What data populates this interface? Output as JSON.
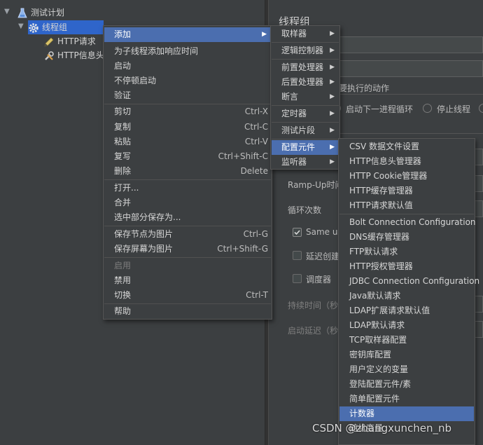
{
  "tree": {
    "items": [
      {
        "label": "测试计划",
        "icon": "flask-icon"
      },
      {
        "label": "线程组",
        "icon": "gear-icon"
      },
      {
        "label": "HTTP请求",
        "icon": "pencil-icon"
      },
      {
        "label": "HTTP信息头",
        "icon": "wrench-icon"
      }
    ]
  },
  "right": {
    "title": "线程组",
    "action_label": "要执行的动作",
    "opt_next_loop": "启动下一进程循环",
    "opt_stop_thread": "停止线程",
    "rampup_label": "Ramp-Up时间",
    "loop_label": "循环次数",
    "same_user_label": "Same us",
    "delay_label": "延迟创建",
    "scheduler_label": "调度器",
    "duration_label": "持续时间（秒",
    "startup_delay_label": "启动延迟（秒"
  },
  "context_menu": {
    "items": [
      {
        "label": "添加",
        "submenu": true
      },
      {
        "label": "为子线程添加响应时间"
      },
      {
        "label": "启动"
      },
      {
        "label": "不停顿启动"
      },
      {
        "label": "验证"
      },
      {
        "label": "剪切",
        "shortcut": "Ctrl-X"
      },
      {
        "label": "复制",
        "shortcut": "Ctrl-C"
      },
      {
        "label": "粘贴",
        "shortcut": "Ctrl-V"
      },
      {
        "label": "复写",
        "shortcut": "Ctrl+Shift-C"
      },
      {
        "label": "删除",
        "shortcut": "Delete"
      },
      {
        "label": "打开..."
      },
      {
        "label": "合并"
      },
      {
        "label": "选中部分保存为..."
      },
      {
        "label": "保存节点为图片",
        "shortcut": "Ctrl-G"
      },
      {
        "label": "保存屏幕为图片",
        "shortcut": "Ctrl+Shift-G"
      },
      {
        "label": "启用"
      },
      {
        "label": "禁用"
      },
      {
        "label": "切换",
        "shortcut": "Ctrl-T"
      },
      {
        "label": "帮助"
      }
    ]
  },
  "add_menu": {
    "items": [
      {
        "label": "取样器"
      },
      {
        "label": "逻辑控制器"
      },
      {
        "label": "前置处理器"
      },
      {
        "label": "后置处理器"
      },
      {
        "label": "断言"
      },
      {
        "label": "定时器"
      },
      {
        "label": "测试片段"
      },
      {
        "label": "配置元件"
      },
      {
        "label": "监听器"
      }
    ]
  },
  "config_menu": {
    "items": [
      {
        "label": "CSV 数据文件设置"
      },
      {
        "label": "HTTP信息头管理器"
      },
      {
        "label": "HTTP Cookie管理器"
      },
      {
        "label": "HTTP缓存管理器"
      },
      {
        "label": "HTTP请求默认值"
      },
      {
        "label": "Bolt Connection Configuration"
      },
      {
        "label": "DNS缓存管理器"
      },
      {
        "label": "FTP默认请求"
      },
      {
        "label": "HTTP授权管理器"
      },
      {
        "label": "JDBC Connection Configuration"
      },
      {
        "label": "Java默认请求"
      },
      {
        "label": "LDAP扩展请求默认值"
      },
      {
        "label": "LDAP默认请求"
      },
      {
        "label": "TCP取样器配置"
      },
      {
        "label": "密钥库配置"
      },
      {
        "label": "用户定义的变量"
      },
      {
        "label": "登陆配置元件/素"
      },
      {
        "label": "简单配置元件"
      },
      {
        "label": "计数器"
      },
      {
        "label": "随机变量"
      }
    ]
  },
  "watermark": "CSDN @zhangxunchen_nb"
}
